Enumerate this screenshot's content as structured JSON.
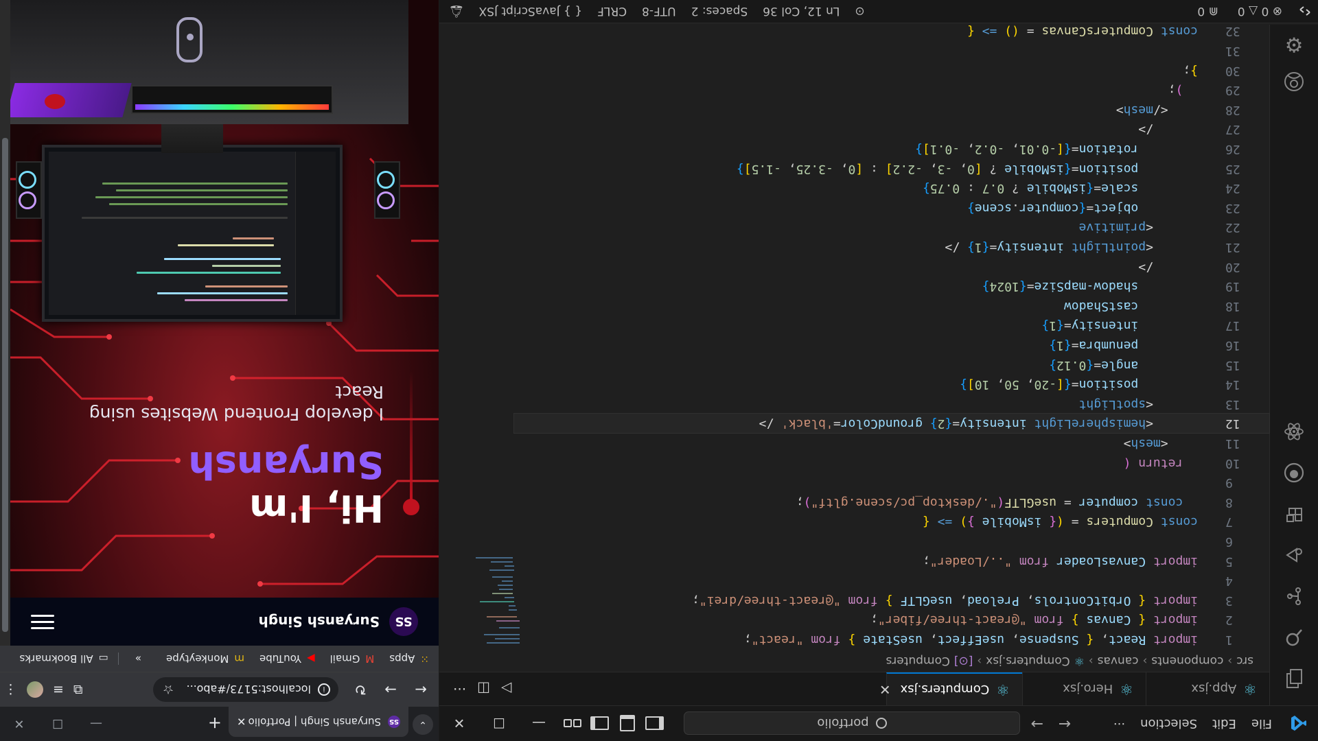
{
  "vscode": {
    "menu": [
      "File",
      "Edit",
      "Selection"
    ],
    "more": "···",
    "search_text": "portfolio",
    "tabs": [
      {
        "label": "App.jsx",
        "active": false
      },
      {
        "label": "Hero.jsx",
        "active": false
      },
      {
        "label": "Computers.jsx",
        "active": true
      }
    ],
    "breadcrumb": [
      "src",
      "components",
      "canvas",
      "Computers.jsx",
      "Computers"
    ],
    "status": {
      "errors": "0",
      "warnings": "0",
      "ports": "0",
      "cursor": "Ln 12, Col 36",
      "spaces": "Spaces: 2",
      "encoding": "UTF-8",
      "eol": "CRLF",
      "language": "JavaScript JSX"
    },
    "line_numbers": [
      "1",
      "2",
      "3",
      "4",
      "5",
      "6",
      "7",
      "8",
      "9",
      "10",
      "11",
      "12",
      "13",
      "14",
      "15",
      "16",
      "17",
      "18",
      "19",
      "20",
      "21",
      "22",
      "23",
      "24",
      "25",
      "26",
      "27",
      "28",
      "29",
      "30",
      "31",
      "32"
    ],
    "current_line": "12",
    "minimap_note": ""
  },
  "browser": {
    "tab_title": "Suryansh Singh | Portfolio",
    "url": "localhost:5173/#abo...",
    "bookmarks": [
      "Apps",
      "Gmail",
      "YouTube",
      "Monkeytype"
    ],
    "bookmarks_more": "»",
    "all_bookmarks": "All Bookmarks",
    "site": {
      "logo": "SS",
      "name": "Suryansh Singh",
      "greeting": "Hi, I'm ",
      "highlight_name": "Suryansh",
      "subtitle": "I develop Frontend Websites using React"
    }
  },
  "colors": {
    "accent": "#0078d4",
    "site_purple": "#915eff",
    "site_red": "#c1121f"
  }
}
